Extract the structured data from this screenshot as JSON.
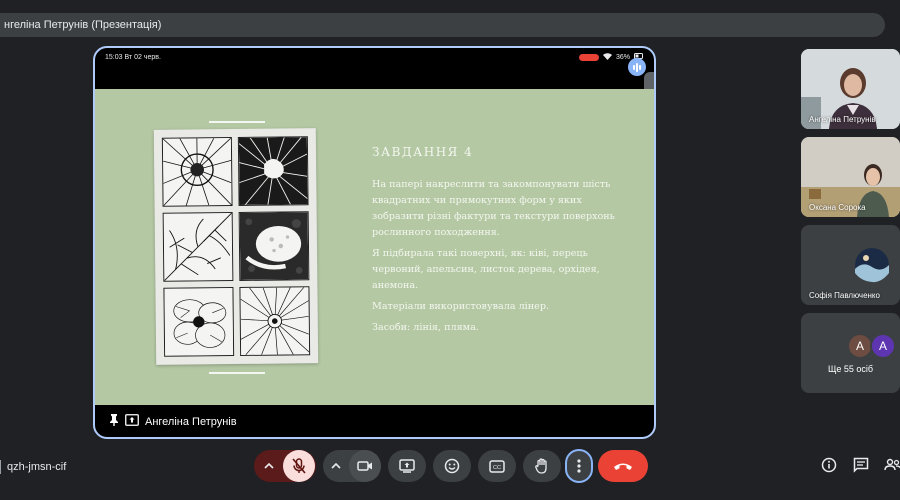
{
  "window": {
    "title": "нгеліна Петрунів (Презентація)"
  },
  "device_status": {
    "time": "15:03",
    "date": "Вт 02 черв.",
    "battery": "36%"
  },
  "slide": {
    "title": "ЗАВДАННЯ 4",
    "paragraphs": [
      "На папері накреслити та закомпонувати шість квадратних чи прямокутних форм у яких зобразити різні фактури та текстури поверхонь рослинного походження.",
      "Я підбирала такі поверхні, як: ківі, перець червоний, апельсин, листок дерева, орхідея, анемона.",
      "Матеріали використовувала лінер.",
      "Засоби: лінія, пляма."
    ]
  },
  "presenter": {
    "name": "Ангеліна Петрунів"
  },
  "participants": [
    {
      "name": "Ангеліна Петрунів"
    },
    {
      "name": "Оксана Сорока"
    },
    {
      "name": "Софія Павлюченко"
    }
  ],
  "more_tile": {
    "avatar_a": "A",
    "avatar_b": "A",
    "label": "Ще 55 осіб"
  },
  "meeting": {
    "code": "qzh-jmsn-cif"
  },
  "colors": {
    "end_call": "#ea4335",
    "mic_off_bg": "#f9dedc",
    "accent_ring": "#aecbfa",
    "slide_bg": "#b4c8a4"
  },
  "toolbar_icons": [
    "chevron-up-icon",
    "mic-off-icon",
    "chevron-up-icon",
    "camera-icon",
    "present-icon",
    "emoji-icon",
    "captions-icon",
    "raise-hand-icon",
    "more-vert-icon",
    "end-call-icon"
  ],
  "side_icons": [
    "info-icon",
    "chat-icon",
    "people-icon"
  ]
}
